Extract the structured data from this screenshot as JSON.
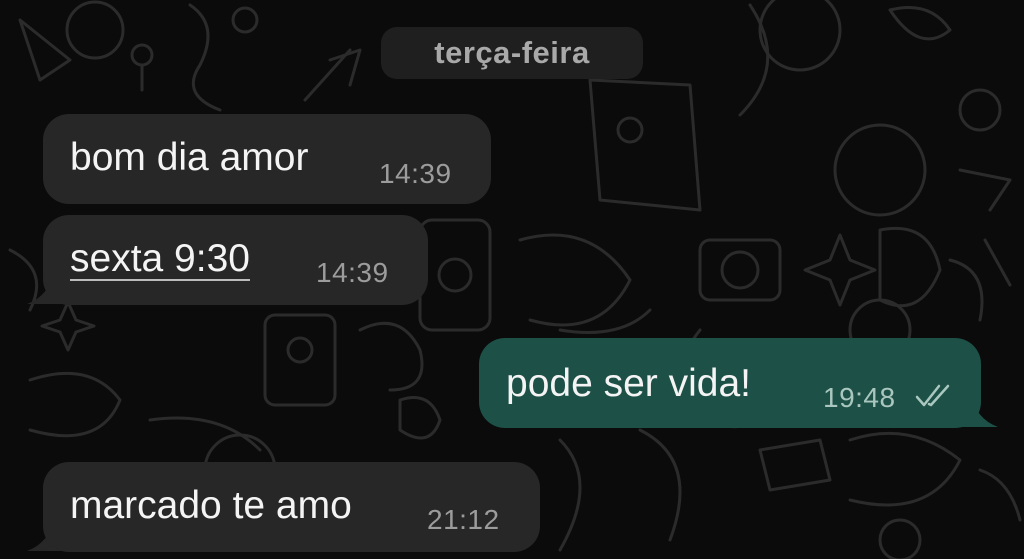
{
  "chat": {
    "date_separator": "terça-feira",
    "messages": [
      {
        "direction": "incoming",
        "text": "bom dia amor",
        "time": "14:39"
      },
      {
        "direction": "incoming",
        "text": "sexta 9:30",
        "time": "14:39",
        "link": true
      },
      {
        "direction": "outgoing",
        "text": "pode ser vida!",
        "time": "19:48",
        "status": "read-double-check-icon"
      },
      {
        "direction": "incoming",
        "text": "marcado te amo",
        "time": "21:12"
      }
    ]
  },
  "colors": {
    "background": "#0b0b0b",
    "incoming_bubble": "#272727",
    "outgoing_bubble": "#1d5046",
    "date_pill": "#1f1f1f"
  }
}
